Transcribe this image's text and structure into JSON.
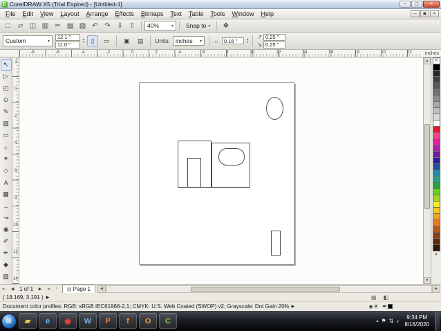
{
  "glyphs": {
    "dropdown": "▾",
    "spin_up": "▴",
    "spin_down": "▾"
  },
  "window": {
    "app_icon": "C",
    "title": "CorelDRAW X5 (Trial Expired) - [Untitled-1]",
    "minimize": "—",
    "maximize": "▢",
    "close": "✕"
  },
  "menubar": {
    "items": [
      "File",
      "Edit",
      "View",
      "Layout",
      "Arrange",
      "Effects",
      "Bitmaps",
      "Text",
      "Table",
      "Tools",
      "Window",
      "Help"
    ],
    "doc_minimize": "—",
    "doc_restore": "▣",
    "doc_close": "✕"
  },
  "toolbar": {
    "buttons": [
      {
        "name": "new-document-button",
        "glyph": "□"
      },
      {
        "name": "open-button",
        "glyph": "▱"
      },
      {
        "name": "save-button",
        "glyph": "◫"
      },
      {
        "name": "print-button",
        "glyph": "▥"
      },
      {
        "name": "cut-button",
        "glyph": "✂"
      },
      {
        "name": "copy-button",
        "glyph": "▤"
      },
      {
        "name": "paste-button",
        "glyph": "▧"
      },
      {
        "name": "undo-button",
        "glyph": "↶"
      },
      {
        "name": "redo-button",
        "glyph": "↷"
      },
      {
        "name": "import-button",
        "glyph": "⇩"
      },
      {
        "name": "export-button",
        "glyph": "⇧"
      }
    ],
    "zoom_value": "40%",
    "snap_label": "Snap to",
    "launcher_glyph": "❖"
  },
  "propbar": {
    "preset_value": "Custom",
    "width_value": "12.1 \"",
    "height_value": "11.0 \"",
    "portrait_glyph": "▯",
    "landscape_glyph": "▭",
    "all_pages_glyph": "▣",
    "current_page_glyph": "▤",
    "units_label": "Units:",
    "units_value": "inches",
    "nudge_glyph": "↔",
    "nudge_value": "0.16 \"",
    "dup_x_glyph": "↗",
    "dup_x_value": "0.25 \"",
    "dup_y_glyph": "↘",
    "dup_y_value": "0.25 \""
  },
  "hruler": {
    "numbers": [
      "-8",
      "-6",
      "-4",
      "-2",
      "0",
      "2",
      "4",
      "6",
      "8",
      "10",
      "12",
      "14",
      "16",
      "18",
      "20",
      "22"
    ],
    "unit_label": "inches"
  },
  "vruler": {
    "numbers": [
      "-2",
      "0",
      "2",
      "4",
      "6",
      "8",
      "10",
      "12",
      "14"
    ]
  },
  "toolbox": {
    "tools": [
      {
        "name": "pick-tool",
        "glyph": "↖"
      },
      {
        "name": "shape-tool",
        "glyph": "▷"
      },
      {
        "name": "crop-tool",
        "glyph": "◰"
      },
      {
        "name": "zoom-tool",
        "glyph": "⊙"
      },
      {
        "name": "freehand-tool",
        "glyph": "✎"
      },
      {
        "name": "smart-fill-tool",
        "glyph": "▧"
      },
      {
        "name": "rectangle-tool",
        "glyph": "▭"
      },
      {
        "name": "ellipse-tool",
        "glyph": "○"
      },
      {
        "name": "polygon-tool",
        "glyph": "✶"
      },
      {
        "name": "basic-shapes-tool",
        "glyph": "◇"
      },
      {
        "name": "text-tool",
        "glyph": "A"
      },
      {
        "name": "table-tool",
        "glyph": "▦"
      },
      {
        "name": "dimension-tool",
        "glyph": "↔"
      },
      {
        "name": "connector-tool",
        "glyph": "↝"
      },
      {
        "name": "blend-tool",
        "glyph": "◉"
      },
      {
        "name": "eyedropper-tool",
        "glyph": "✐"
      },
      {
        "name": "outline-pen-tool",
        "glyph": "✒"
      },
      {
        "name": "fill-tool",
        "glyph": "◆"
      },
      {
        "name": "interactive-fill-tool",
        "glyph": "▨"
      }
    ]
  },
  "canvas": {
    "shapes": [
      {
        "name": "ellipse-shape",
        "style": "left:183px;top:20px;width:25px;height:33px;border-radius:50%"
      },
      {
        "name": "rectangle-large-shape",
        "style": "left:55px;top:83px;width:49px;height:68px"
      },
      {
        "name": "rectangle-door-shape",
        "style": "left:69px;top:108px;width:20px;height:43px"
      },
      {
        "name": "rectangle-right-shape",
        "style": "left:104px;top:86px;width:56px;height:65px"
      },
      {
        "name": "rounded-rectangle-shape",
        "style": "left:114px;top:94px;width:38px;height:25px;border-radius:12px"
      },
      {
        "name": "rectangle-small-shape",
        "style": "left:190px;top:213px;width:14px;height:36px"
      }
    ]
  },
  "palette": {
    "none_glyph": "✕",
    "colors": [
      "#000000",
      "#262626",
      "#404040",
      "#595959",
      "#737373",
      "#8c8c8c",
      "#a6a6a6",
      "#bfbfbf",
      "#d9d9d9",
      "#ffffff",
      "#e8192c",
      "#f2428c",
      "#e81ca2",
      "#b01caa",
      "#6a1ca5",
      "#2b1ca5",
      "#1c50a5",
      "#1c8ca5",
      "#1ca58c",
      "#1ca53e",
      "#5fd320",
      "#a5d81c",
      "#f2ef1c",
      "#f2c81c",
      "#f2a51c",
      "#f2781c",
      "#b55716",
      "#8c3c10",
      "#5e2a0d",
      "#301508"
    ],
    "scroll_down_glyph": "▾"
  },
  "scrollbars": {
    "up": "▲",
    "down": "▼",
    "left": "◀",
    "right": "▶"
  },
  "pagerow": {
    "first": "⇤",
    "prev": "◀",
    "label": "1 of 1",
    "next": "▶",
    "last": "⇥",
    "add_page": "▫",
    "tab_icon": "▤",
    "tab_label": "Page 1"
  },
  "status": {
    "coords": "( 18.169, 3.191 )",
    "marker": "▶",
    "row1_icons": [
      {
        "name": "clipboard-status-icon",
        "glyph": "▤"
      },
      {
        "name": "color-proof-status-icon",
        "glyph": "◧"
      }
    ],
    "profiles": "Document color profiles: RGB: sRGB IEC61966-2.1; CMYK: U.S. Web Coated (SWOP) v2; Grayscale: Dot Gain 20%",
    "fill_icon": "◈",
    "fill_none": "✕",
    "outline_icon": "✒",
    "outline_swatch_style": "background:#000000"
  },
  "taskbar": {
    "start_glyph": "⊞",
    "apps": [
      {
        "name": "folder-icon",
        "glyph": "▰",
        "color": "#eec250"
      },
      {
        "name": "internet-explorer-icon",
        "glyph": "e",
        "color": "#62b8ea"
      },
      {
        "name": "chrome-icon",
        "glyph": "◉",
        "color": "#e8443c"
      },
      {
        "name": "word-icon",
        "glyph": "W",
        "color": "#7fb2e8"
      },
      {
        "name": "powerpoint-icon",
        "glyph": "P",
        "color": "#f0833c"
      },
      {
        "name": "firefox-icon",
        "glyph": "f",
        "color": "#ff8e2e"
      },
      {
        "name": "outlook-icon",
        "glyph": "O",
        "color": "#f3a73c"
      },
      {
        "name": "coreldraw-icon",
        "glyph": "C",
        "color": "#86d04e"
      }
    ],
    "tray": {
      "caret": "▴",
      "icons": [
        {
          "name": "action-center-icon",
          "glyph": "⚑"
        },
        {
          "name": "network-icon",
          "glyph": "⇅"
        },
        {
          "name": "volume-icon",
          "glyph": "♪"
        }
      ],
      "time": "9:34 PM",
      "date": "8/16/2020"
    }
  }
}
